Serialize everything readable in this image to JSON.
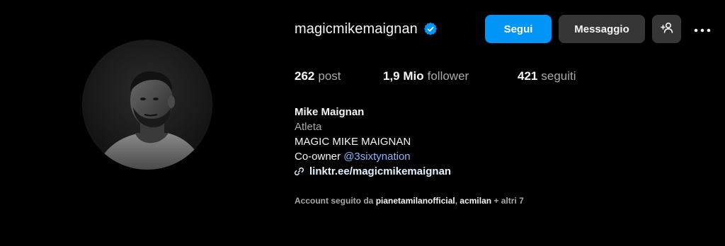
{
  "profile": {
    "username": "magicmikemaignan",
    "verified": true,
    "accent_color": "#0095f6",
    "verified_color": "#0095f6"
  },
  "actions": {
    "follow_label": "Segui",
    "message_label": "Messaggio",
    "suggest_icon": "person-add-icon",
    "more_icon": "more-horizontal-icon"
  },
  "stats": {
    "posts_count": "262",
    "posts_label": "post",
    "followers_count": "1,9 Mio",
    "followers_label": "follower",
    "following_count": "421",
    "following_label": "seguiti"
  },
  "bio": {
    "full_name": "Mike Maignan",
    "category": "Atleta",
    "line1": "MAGIC MIKE MAIGNAN",
    "line2_prefix": "Co-owner",
    "line2_mention": "@3sixtynation",
    "link_icon": "link-icon",
    "link_text": "linktr.ee/magicmikemaignan"
  },
  "followed_by": {
    "prefix": "Account seguito da",
    "account1": "pianetamilanofficial",
    "separator": ",",
    "account2": "acmilan",
    "suffix": "+ altri 7"
  }
}
